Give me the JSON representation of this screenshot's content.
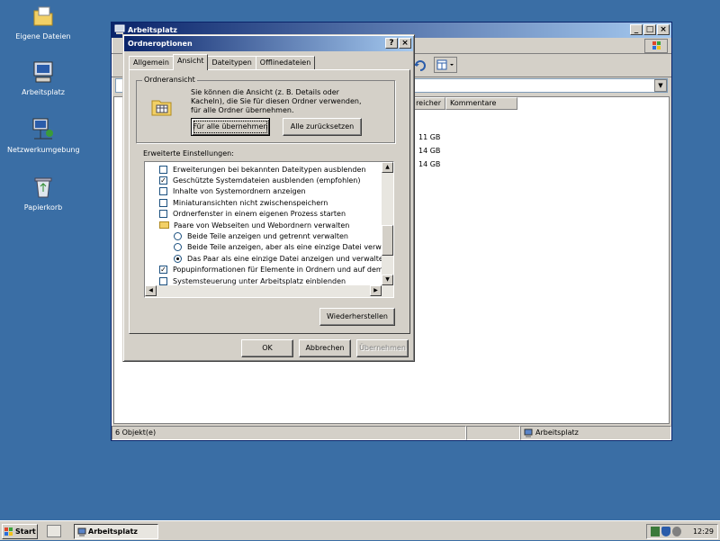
{
  "desktop": {
    "icons": [
      {
        "label": "Eigene Dateien",
        "icon": "my-documents-icon"
      },
      {
        "label": "Arbeitsplatz",
        "icon": "my-computer-icon"
      },
      {
        "label": "Netzwerkumgebung",
        "icon": "network-icon"
      },
      {
        "label": "Papierkorb",
        "icon": "recycle-bin-icon"
      }
    ]
  },
  "explorer": {
    "title": "Arbeitsplatz",
    "caption_buttons": {
      "minimize": "_",
      "maximize": "□",
      "close": "×"
    },
    "columns": {
      "free": "reicher",
      "comments": "Kommentare"
    },
    "sizes": [
      "11 GB",
      "14 GB",
      "14 GB"
    ],
    "status": {
      "objects": "6 Objekt(e)",
      "location": "Arbeitsplatz"
    }
  },
  "dialog": {
    "title": "Ordneroptionen",
    "caption_buttons": {
      "help": "?",
      "close": "×"
    },
    "tabs": [
      "Allgemein",
      "Ansicht",
      "Dateitypen",
      "Offlinedateien"
    ],
    "active_tab": "Ansicht",
    "folder_view": {
      "legend": "Ordneransicht",
      "description": "Sie können die Ansicht (z. B. Details oder Kacheln), die Sie für diesen Ordner verwenden, für alle Ordner übernehmen.",
      "apply_all": "Für alle übernehmen",
      "reset_all": "Alle zurücksetzen"
    },
    "advanced": {
      "label": "Erweiterte Einstellungen:",
      "items": [
        {
          "type": "checkbox",
          "checked": false,
          "label": "Erweiterungen bei bekannten Dateitypen ausblenden"
        },
        {
          "type": "checkbox",
          "checked": true,
          "label": "Geschützte Systemdateien ausblenden (empfohlen)"
        },
        {
          "type": "checkbox",
          "checked": false,
          "label": "Inhalte von Systemordnern anzeigen"
        },
        {
          "type": "checkbox",
          "checked": false,
          "label": "Miniaturansichten nicht zwischenspeichern"
        },
        {
          "type": "checkbox",
          "checked": false,
          "label": "Ordnerfenster in einem eigenen Prozess starten"
        },
        {
          "type": "folder",
          "label": "Paare von Webseiten und Webordnern verwalten"
        },
        {
          "type": "radio",
          "checked": false,
          "label": "Beide Teile anzeigen und getrennt verwalten"
        },
        {
          "type": "radio",
          "checked": false,
          "label": "Beide Teile anzeigen, aber als eine einzige Datei verwalten"
        },
        {
          "type": "radio",
          "checked": true,
          "label": "Das Paar als eine einzige Datei anzeigen und verwalten"
        },
        {
          "type": "checkbox",
          "checked": true,
          "label": "Popupinformationen für Elemente in Ordnern und auf dem Desk"
        },
        {
          "type": "checkbox",
          "checked": false,
          "label": "Systemsteuerung unter Arbeitsplatz einblenden"
        }
      ]
    },
    "restore_defaults": "Wiederherstellen",
    "ok": "OK",
    "cancel": "Abbrechen",
    "apply": "Übernehmen"
  },
  "taskbar": {
    "start": "Start",
    "task": "Arbeitsplatz",
    "clock": "12:29"
  }
}
